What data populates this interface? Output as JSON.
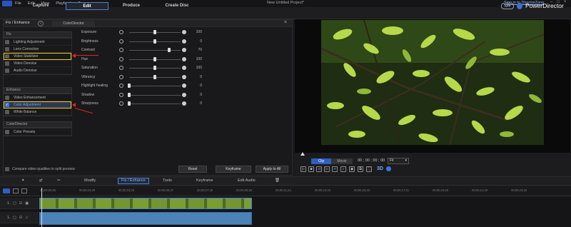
{
  "window": {
    "title": "New Untitled Project*",
    "menu": [
      "File",
      "Edit",
      "View",
      "Playback"
    ],
    "sign_in": "Sign in to DirectorZone",
    "app_badge": "APP",
    "app_name": "PowerDirector"
  },
  "tabs": [
    "Capture",
    "Edit",
    "Produce",
    "Create Disc"
  ],
  "panel": {
    "tab_fix": "Fix / Enhance",
    "tab_colordirector": "ColorDirector",
    "fix_header": "Fix",
    "fix_items": [
      "Lighting Adjustment",
      "Lens Correction",
      "Video Stabilizer",
      "Video Denoise",
      "Audio Denoise"
    ],
    "enhance_header": "Enhance",
    "enhance_items": [
      "Video Enhancement",
      "Color Adjustment",
      "White Balance"
    ],
    "cd_header": "ColorDirector",
    "cd_items": [
      "Color Presets"
    ],
    "sliders": [
      {
        "label": "Exposure",
        "value": "100"
      },
      {
        "label": "Brightness",
        "value": "0"
      },
      {
        "label": "Contrast",
        "value": "70"
      },
      {
        "label": "Hue",
        "value": "100"
      },
      {
        "label": "Saturation",
        "value": "100"
      },
      {
        "label": "Vibrancy",
        "value": "0"
      },
      {
        "label": "Highlight healing",
        "value": "0"
      },
      {
        "label": "Shadow",
        "value": "0"
      },
      {
        "label": "Sharpness",
        "value": "0"
      }
    ],
    "slider_levels": [
      0.5,
      0.5,
      0.78,
      0.5,
      0.5,
      0.5,
      0.0,
      0.0,
      0.0
    ],
    "compare": "Compare video qualities in split preview",
    "reset": "Reset",
    "keyframe": "Keyframe",
    "apply_all": "Apply to All"
  },
  "preview": {
    "clip": "Clip",
    "movie": "Movie",
    "timecode": "00 ; 00 ; 00 ; 00",
    "fit": "Fit",
    "fps": "3D"
  },
  "toolbar": {
    "modify": "Modify",
    "fix_enhance": "Fix / Enhance",
    "tools": "Tools",
    "keyframe": "Keyframe",
    "edit_audio": "Edit Audio"
  },
  "timeline": {
    "ticks": [
      "00;00;00;00",
      "00;00;01;29",
      "00;00;03;28",
      "00;00;05;27",
      "00;00;07;26",
      "00;00;09;25",
      "00;00;11;24",
      "00;00;13;23",
      "00;00;15;22",
      "00;00;17;21",
      "00;00;19;20",
      "00;00;21;19",
      "00;00;23;18"
    ],
    "tracks": [
      "1.",
      "1."
    ]
  },
  "colors": {
    "accent": "#3a73e0",
    "highlight": "#f2cc1d",
    "arrow": "#e52222"
  }
}
